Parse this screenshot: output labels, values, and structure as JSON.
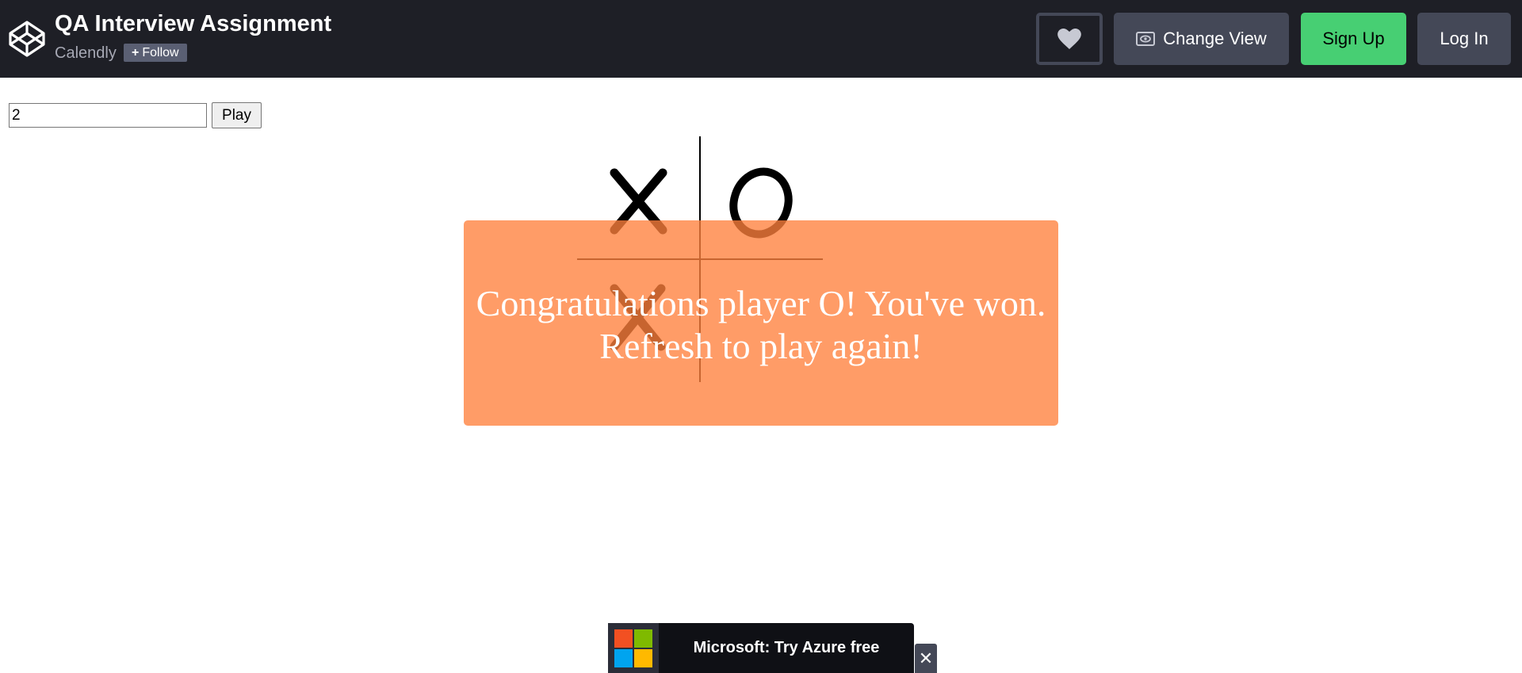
{
  "header": {
    "title": "QA Interview Assignment",
    "owner": "Calendly",
    "follow_label": "Follow",
    "follow_plus": "+",
    "heart_icon": "heart-icon",
    "change_view_label": "Change View",
    "change_view_icon": "eye-icon",
    "signup_label": "Sign Up",
    "login_label": "Log In"
  },
  "game": {
    "size_value": "2",
    "play_label": "Play",
    "board": [
      [
        "X",
        "O"
      ],
      [
        "X",
        ""
      ]
    ],
    "message_line1": "Congratulations player O! You've won.",
    "message_line2": "Refresh to play again!"
  },
  "ad": {
    "text": "Microsoft: Try Azure free",
    "close_label": "✕"
  },
  "colors": {
    "header_bg": "#1e1f26",
    "signup_green": "#47cf73",
    "overlay_orange": "#ff803c"
  }
}
